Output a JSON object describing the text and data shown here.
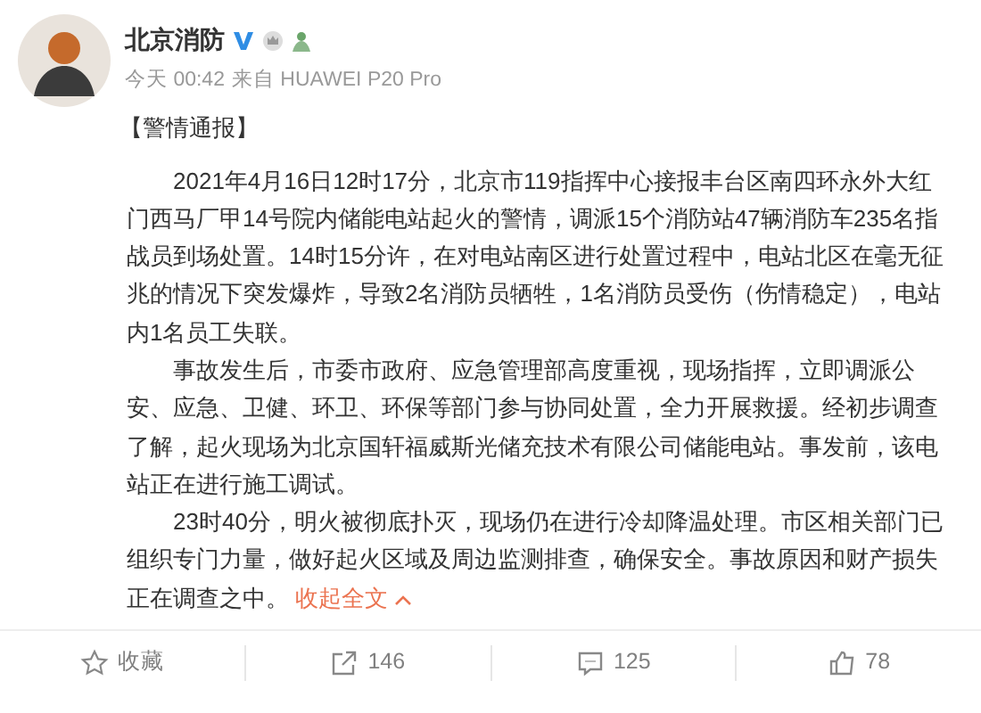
{
  "post": {
    "author": "北京消防",
    "time": "今天 00:42",
    "source": "来自 HUAWEI P20 Pro",
    "heading": "【警情通报】",
    "paragraphs": [
      {
        "text": "2021年4月16日12时17分，北京市119指挥中心接报丰台区南四环永外大红门西马厂甲14号院内储能电站起火的警情，调派15个消防站47辆消防车235名指战员到场处置。14时15分许，在对电站南区进行处置过程中，电站北区在毫无征兆的情况下突发爆炸，导致2名消防员牺牲，1名消防员受伤（伤情稳定），电站内1名员工失联。"
      },
      {
        "text": "事故发生后，市委市政府、应急管理部高度重视，现场指挥，立即调派公安、应急、卫健、环卫、环保等部门参与协同处置，全力开展救援。经初步调查了解，起火现场为北京国轩福威斯光储充技术有限公司储能电站。事发前，该电站正在进行施工调试。"
      },
      {
        "text": "23时40分，明火被彻底扑灭，现场仍在进行冷却降温处理。市区相关部门已组织专门力量，做好起火区域及周边监测排查，确保安全。事故原因和财产损失正在调查之中。"
      }
    ],
    "collapse_link": "收起全文"
  },
  "actions": [
    {
      "kind": "favorite",
      "label": "收藏"
    },
    {
      "kind": "repost",
      "label": "146"
    },
    {
      "kind": "comment",
      "label": "125"
    },
    {
      "kind": "like",
      "label": "78"
    }
  ]
}
